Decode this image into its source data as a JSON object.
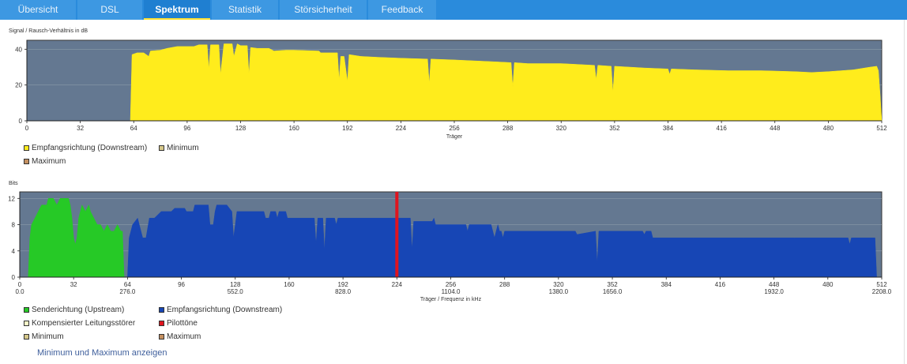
{
  "tabs": [
    {
      "label": "Übersicht",
      "active": false
    },
    {
      "label": "DSL",
      "active": false
    },
    {
      "label": "Spektrum",
      "active": true
    },
    {
      "label": "Statistik",
      "active": false
    },
    {
      "label": "Störsicherheit",
      "active": false
    },
    {
      "label": "Feedback",
      "active": false
    }
  ],
  "snr_panel": {
    "ylabel": "Signal / Rausch-Verhältnis in dB",
    "xlabel": "Träger",
    "legend": [
      "Empfangsrichtung (Downstream)",
      "Minimum",
      "Maximum"
    ]
  },
  "bits_panel": {
    "ylabel": "Bits",
    "xlabel": "Träger / Frequenz in kHz",
    "legend": [
      "Senderichtung (Upstream)",
      "Empfangsrichtung (Downstream)",
      "Kompensierter Leitungsstörer",
      "Pilottöne",
      "Minimum",
      "Maximum"
    ]
  },
  "show_minmax_link": "Minimum und Maximum anzeigen",
  "colors": {
    "tab_bar": "#2a8bdc",
    "plot_bg": "#647891",
    "snr_fill": "#ffec1c",
    "upstream": "#26c926",
    "downstream": "#1746b5",
    "pilot": "#e0141e",
    "link": "#3f5f9c",
    "legend_compensated": "#f8f8c8",
    "legend_minimum": "#d6c88a",
    "legend_maximum": "#c49060"
  },
  "chart_data": [
    {
      "type": "area",
      "xlim": [
        0,
        512
      ],
      "ylim": [
        0,
        45
      ],
      "x_ticks": [
        0,
        32,
        64,
        96,
        128,
        160,
        192,
        224,
        256,
        288,
        320,
        352,
        384,
        416,
        448,
        480,
        512
      ],
      "y_ticks": [
        0,
        20,
        40
      ],
      "series": [
        {
          "name": "Empfangsrichtung (Downstream)",
          "points": [
            [
              0,
              0
            ],
            [
              62,
              0
            ],
            [
              63,
              37
            ],
            [
              66,
              38
            ],
            [
              70,
              38
            ],
            [
              73,
              36
            ],
            [
              74,
              39
            ],
            [
              80,
              39.5
            ],
            [
              84,
              40.5
            ],
            [
              90,
              41.5
            ],
            [
              100,
              41.5
            ],
            [
              103,
              42.5
            ],
            [
              108,
              42.5
            ],
            [
              109,
              29
            ],
            [
              110,
              42.5
            ],
            [
              115,
              42.5
            ],
            [
              116,
              26
            ],
            [
              118,
              43
            ],
            [
              123,
              43
            ],
            [
              124,
              36
            ],
            [
              126,
              43
            ],
            [
              128,
              42
            ],
            [
              132,
              42
            ],
            [
              133,
              26
            ],
            [
              134,
              41
            ],
            [
              138,
              40.5
            ],
            [
              145,
              40.5
            ],
            [
              148,
              39
            ],
            [
              155,
              39.5
            ],
            [
              160,
              39.5
            ],
            [
              175,
              39
            ],
            [
              176,
              38
            ],
            [
              186,
              38
            ],
            [
              187,
              23
            ],
            [
              188,
              36
            ],
            [
              190,
              36
            ],
            [
              192,
              22
            ],
            [
              193,
              37
            ],
            [
              200,
              36
            ],
            [
              210,
              35.5
            ],
            [
              224,
              35
            ],
            [
              240,
              34.5
            ],
            [
              241,
              21
            ],
            [
              242,
              34.5
            ],
            [
              256,
              34
            ],
            [
              280,
              33
            ],
            [
              290,
              32.5
            ],
            [
              291,
              19
            ],
            [
              292,
              32.5
            ],
            [
              300,
              32
            ],
            [
              320,
              32
            ],
            [
              340,
              31
            ],
            [
              341,
              23
            ],
            [
              342,
              31
            ],
            [
              350,
              30.5
            ],
            [
              351,
              16
            ],
            [
              352,
              30.5
            ],
            [
              370,
              29.5
            ],
            [
              384,
              29
            ],
            [
              385,
              26
            ],
            [
              386,
              29
            ],
            [
              400,
              28.5
            ],
            [
              420,
              28
            ],
            [
              440,
              28
            ],
            [
              460,
              27.5
            ],
            [
              470,
              27
            ],
            [
              480,
              27.5
            ],
            [
              495,
              28.5
            ],
            [
              505,
              30
            ],
            [
              509,
              30.5
            ],
            [
              510,
              28
            ],
            [
              511,
              15
            ],
            [
              512,
              0
            ]
          ]
        }
      ]
    },
    {
      "type": "area",
      "xlim": [
        0,
        512
      ],
      "ylim": [
        0,
        13
      ],
      "x_ticks": [
        0,
        32,
        64,
        96,
        128,
        160,
        192,
        224,
        256,
        288,
        320,
        352,
        384,
        416,
        448,
        480,
        512
      ],
      "x_tick_labels": [
        "0\n0.0",
        "32",
        "64\n276.0",
        "96",
        "128\n552.0",
        "160",
        "192\n828.0",
        "224",
        "256\n1104.0",
        "288",
        "320\n1380.0",
        "352\n1656.0",
        "384",
        "416",
        "448\n1932.0",
        "480",
        "512\n2208.0"
      ],
      "y_ticks": [
        0,
        4,
        8,
        12
      ],
      "series": [
        {
          "name": "Senderichtung (Upstream)",
          "points": [
            [
              5,
              0
            ],
            [
              6,
              6
            ],
            [
              7,
              8
            ],
            [
              9,
              9
            ],
            [
              11,
              10
            ],
            [
              13,
              11
            ],
            [
              16,
              11
            ],
            [
              17,
              12
            ],
            [
              20,
              12
            ],
            [
              22,
              11
            ],
            [
              24,
              12
            ],
            [
              29,
              12
            ],
            [
              30,
              11
            ],
            [
              31,
              9
            ],
            [
              32,
              6
            ],
            [
              33,
              5
            ],
            [
              34,
              6
            ],
            [
              35,
              9
            ],
            [
              36,
              10
            ],
            [
              37,
              11
            ],
            [
              39,
              10
            ],
            [
              41,
              11
            ],
            [
              42,
              10
            ],
            [
              44,
              9
            ],
            [
              46,
              8
            ],
            [
              48,
              8
            ],
            [
              50,
              7
            ],
            [
              52,
              8
            ],
            [
              54,
              7
            ],
            [
              56,
              7
            ],
            [
              58,
              8
            ],
            [
              60,
              7
            ],
            [
              61,
              7
            ],
            [
              62,
              0
            ]
          ]
        },
        {
          "name": "Empfangsrichtung (Downstream)",
          "points": [
            [
              64,
              0
            ],
            [
              65,
              6
            ],
            [
              67,
              8
            ],
            [
              70,
              9
            ],
            [
              71,
              8
            ],
            [
              73,
              6
            ],
            [
              75,
              6
            ],
            [
              77,
              9
            ],
            [
              80,
              9
            ],
            [
              84,
              10
            ],
            [
              90,
              10
            ],
            [
              92,
              10.5
            ],
            [
              98,
              10.5
            ],
            [
              99,
              10
            ],
            [
              103,
              10
            ],
            [
              104,
              11
            ],
            [
              112,
              11
            ],
            [
              113,
              8
            ],
            [
              115,
              8
            ],
            [
              116,
              10
            ],
            [
              117,
              11
            ],
            [
              123,
              11
            ],
            [
              126,
              10
            ],
            [
              127,
              6
            ],
            [
              128,
              8
            ],
            [
              129,
              10
            ],
            [
              145,
              10
            ],
            [
              146,
              9
            ],
            [
              148,
              9
            ],
            [
              149,
              10
            ],
            [
              152,
              10
            ],
            [
              153,
              9
            ],
            [
              154,
              10
            ],
            [
              158,
              10
            ],
            [
              159,
              9
            ],
            [
              175,
              9
            ],
            [
              176,
              5
            ],
            [
              177,
              9
            ],
            [
              180,
              9
            ],
            [
              181,
              4
            ],
            [
              182,
              9
            ],
            [
              187,
              9
            ],
            [
              188,
              8
            ],
            [
              189,
              9
            ],
            [
              200,
              9
            ],
            [
              210,
              9
            ],
            [
              224,
              9
            ],
            [
              232,
              9
            ],
            [
              233,
              4
            ],
            [
              234,
              8.5
            ],
            [
              245,
              8.5
            ],
            [
              246,
              9
            ],
            [
              247,
              8
            ],
            [
              256,
              8
            ],
            [
              265,
              8
            ],
            [
              266,
              7
            ],
            [
              267,
              8
            ],
            [
              280,
              8
            ],
            [
              282,
              6
            ],
            [
              283,
              7
            ],
            [
              284,
              8
            ],
            [
              285,
              7
            ],
            [
              286,
              7
            ],
            [
              287,
              6
            ],
            [
              288,
              7
            ],
            [
              300,
              7
            ],
            [
              330,
              7
            ],
            [
              331,
              6.5
            ],
            [
              342,
              7
            ],
            [
              343,
              2
            ],
            [
              344,
              7
            ],
            [
              370,
              7
            ],
            [
              371,
              6.5
            ],
            [
              372,
              7
            ],
            [
              375,
              7
            ],
            [
              376,
              6
            ],
            [
              400,
              6
            ],
            [
              430,
              6
            ],
            [
              460,
              6
            ],
            [
              492,
              6
            ],
            [
              493,
              5
            ],
            [
              494,
              6
            ],
            [
              508,
              6
            ],
            [
              509,
              0
            ]
          ]
        },
        {
          "name": "Pilottöne",
          "points": [
            [
              224,
              0
            ],
            [
              224,
              13
            ]
          ]
        }
      ]
    }
  ]
}
